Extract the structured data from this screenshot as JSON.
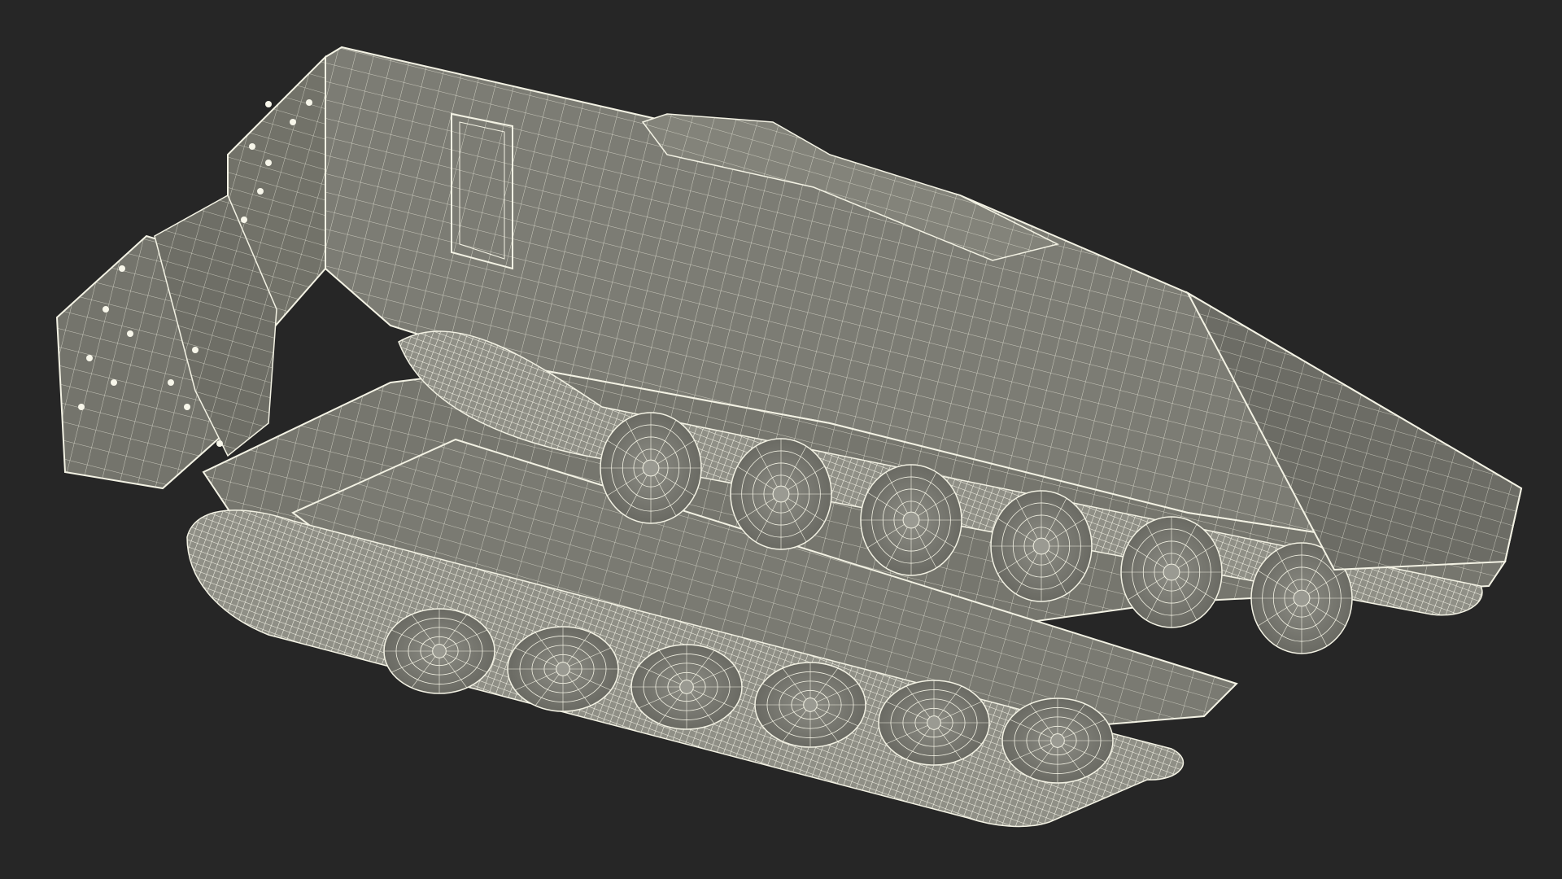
{
  "scene": {
    "background_color": "#262626",
    "model_fill_color": "#7b7b73",
    "model_shade_color": "#5f5f58",
    "wire_color": "#f3f2e4",
    "track_color": "#8a8a82",
    "wheel_count_per_side": 6,
    "visible_text": ""
  }
}
